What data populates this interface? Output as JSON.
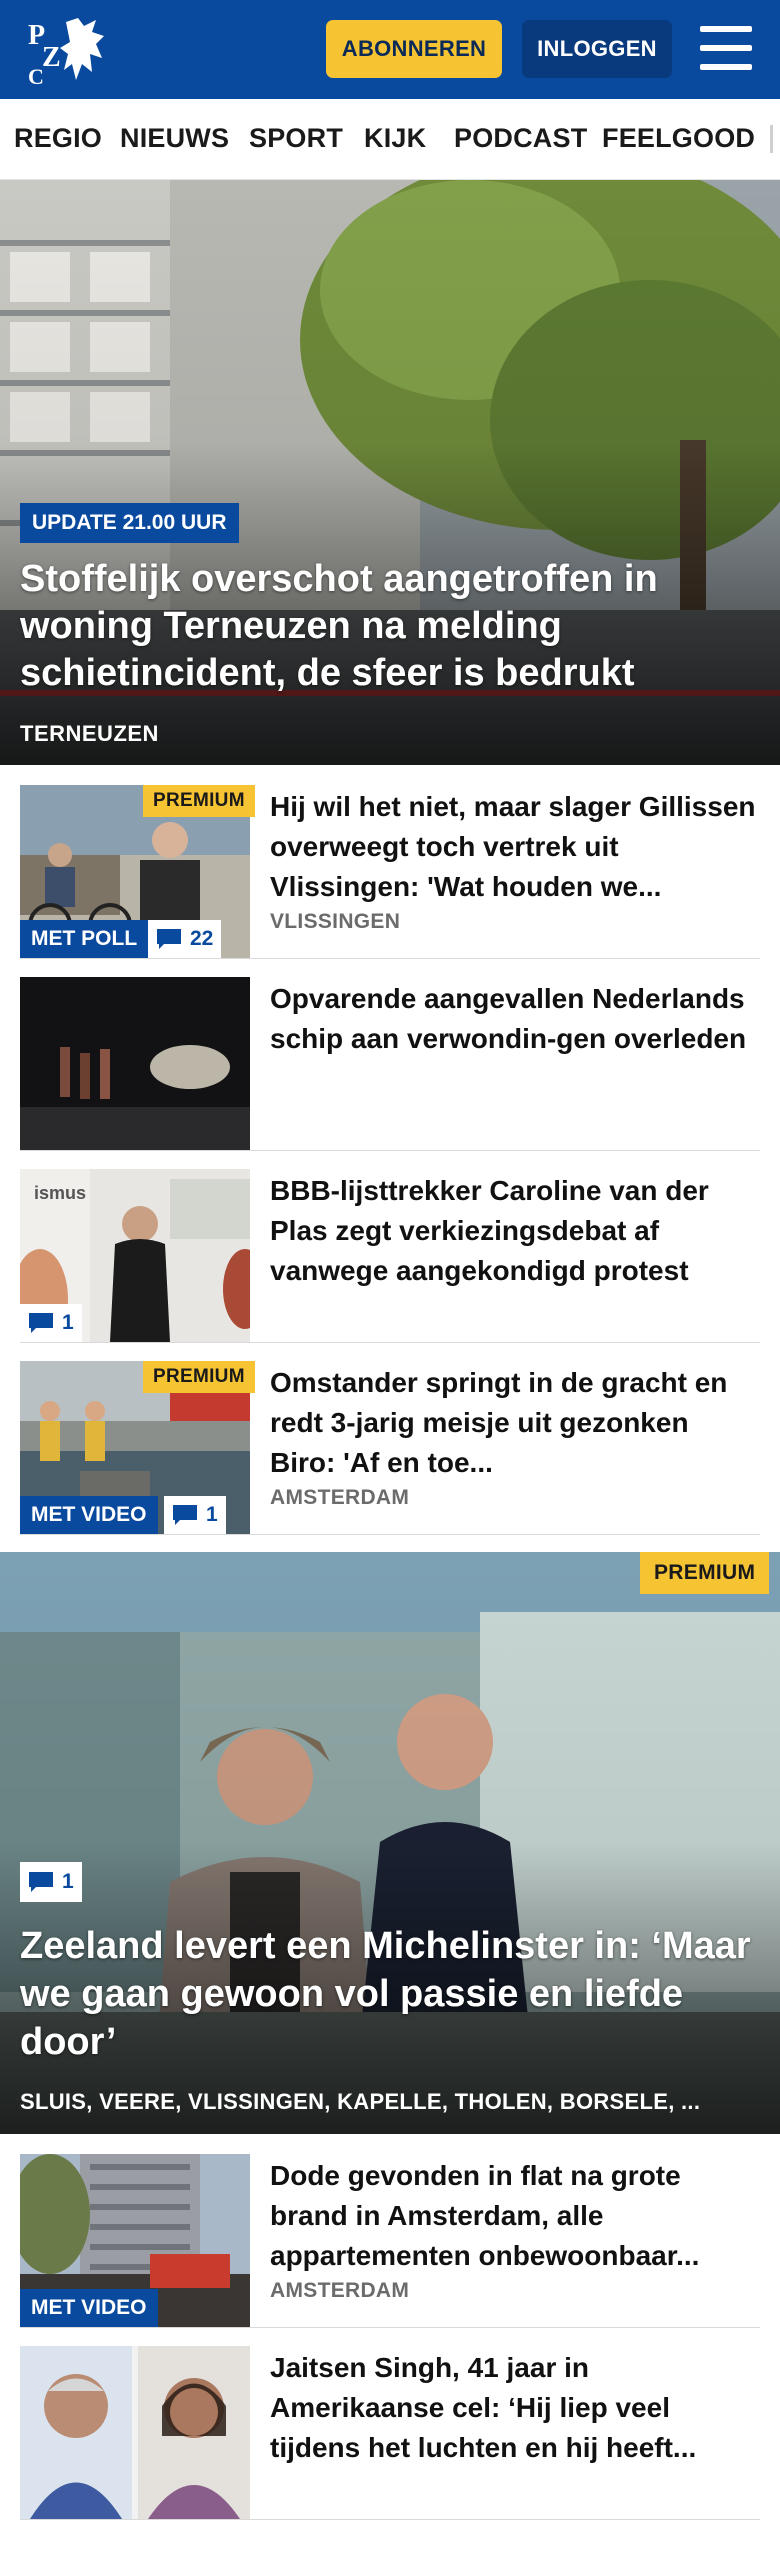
{
  "header": {
    "logo_text": "PZC",
    "subscribe_label": "ABONNEREN",
    "login_label": "INLOGGEN",
    "brand_color": "#0a4a9e",
    "accent_color": "#f6c433"
  },
  "nav": {
    "items": [
      "REGIO",
      "NIEUWS",
      "SPORT",
      "KIJK",
      "PODCAST",
      "FEELGOOD"
    ]
  },
  "hero": {
    "badge": "UPDATE 21.00 UUR",
    "title": "Stoffelijk overschot aangetroffen in woning Terneuzen na melding schietincident, de sfeer is bedrukt",
    "location": "TERNEUZEN"
  },
  "articles": [
    {
      "title": "Hij wil het niet, maar slager Gillissen overweegt toch vertrek uit Vlissingen: 'Wat houden we...",
      "location": "VLISSINGEN",
      "premium": "PREMIUM",
      "tag": "MET POLL",
      "comments": "22"
    },
    {
      "title": "Opvarende aangevallen Nederlands schip aan verwondin-gen overleden"
    },
    {
      "title": "BBB-lijsttrekker Caroline van der Plas zegt verkiezingsdebat af vanwege aangekondigd protest",
      "comments": "1"
    },
    {
      "title": "Omstander springt in de gracht en redt 3-jarig meisje uit gezonken Biro: 'Af en toe...",
      "location": "AMSTERDAM",
      "premium": "PREMIUM",
      "tag": "MET VIDEO",
      "comments": "1"
    }
  ],
  "feature": {
    "premium": "PREMIUM",
    "comments": "1",
    "title": "Zeeland levert een Michelinster in: ‘Maar we gaan gewoon vol passie en liefde door’",
    "location": "SLUIS, VEERE, VLISSINGEN, KAPELLE, THOLEN, BORSELE, ..."
  },
  "more_articles": [
    {
      "title": "Dode gevonden in flat na grote brand in Amsterdam, alle appartementen onbewoonbaar...",
      "location": "AMSTERDAM",
      "tag": "MET VIDEO"
    },
    {
      "title": "Jaitsen Singh, 41 jaar in Amerikaanse cel: ‘Hij liep veel tijdens het luchten en hij heeft..."
    }
  ]
}
